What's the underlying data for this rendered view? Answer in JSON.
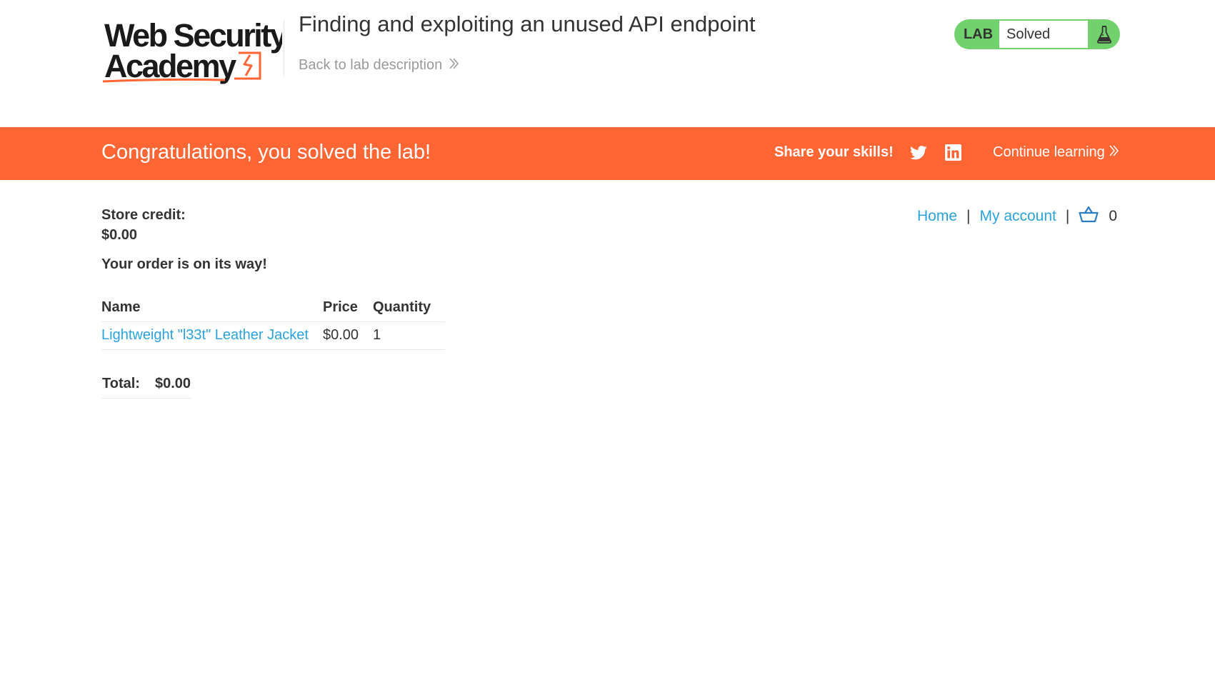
{
  "header": {
    "logo_text_line1": "Web Security",
    "logo_text_line2": "Academy",
    "lab_title": "Finding and exploiting an unused API endpoint",
    "back_link": "Back to lab description",
    "status_widget": {
      "tag": "LAB",
      "status": "Solved",
      "color": "#70d16d",
      "icon": "flask-icon"
    }
  },
  "banner": {
    "message": "Congratulations, you solved the lab!",
    "share_label": "Share your skills!",
    "twitter_icon": "twitter-icon",
    "linkedin_icon": "linkedin-icon",
    "continue_link": "Continue learning",
    "color": "#ff6633"
  },
  "account": {
    "store_credit_label": "Store credit:",
    "store_credit_value": "$0.00",
    "order_message": "Your order is on its way!"
  },
  "nav": {
    "home": "Home",
    "my_account": "My account",
    "separator": "|",
    "cart_icon": "basket-icon",
    "cart_count": "0",
    "link_color": "#2aa2dc"
  },
  "order": {
    "columns": [
      "Name",
      "Price",
      "Quantity"
    ],
    "rows": [
      {
        "name": "Lightweight \"l33t\" Leather Jacket",
        "price": "$0.00",
        "quantity": "1"
      }
    ],
    "total_label": "Total:",
    "total_value": "$0.00"
  }
}
